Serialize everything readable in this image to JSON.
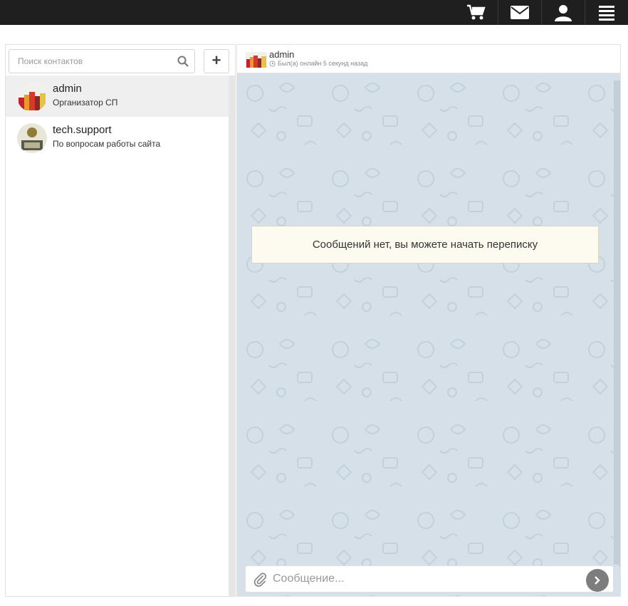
{
  "topbar": {
    "icons": [
      "cart-icon",
      "mail-icon",
      "user-icon",
      "menu-icon"
    ]
  },
  "contacts_panel": {
    "search_placeholder": "Поиск контактов",
    "add_label": "+",
    "contacts": [
      {
        "name": "admin",
        "subtitle": "Организатор СП",
        "active": true
      },
      {
        "name": "tech.support",
        "subtitle": "По вопросам работы сайта",
        "active": false
      }
    ]
  },
  "chat": {
    "header_name": "admin",
    "header_status": "Был(а) онлайн 5 секунд назад",
    "empty_message": "Сообщений нет, вы можете начать переписку",
    "composer_placeholder": "Сообщение..."
  },
  "colors": {
    "topbar_bg": "#1f1f1f",
    "chat_bg": "#d5e0e8",
    "note_bg": "#fdfbf0",
    "send_button": "#7d7d7d"
  }
}
